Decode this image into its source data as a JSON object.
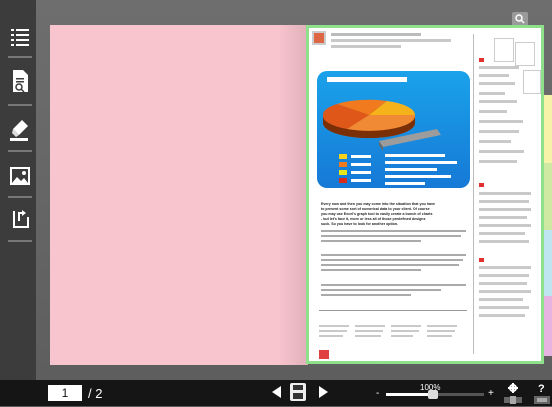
{
  "toolbar": {
    "page_current": "1",
    "page_total": "/ 2",
    "zoom_label": "100%",
    "zoom_level": 0.48,
    "zoom_minus": "-",
    "zoom_plus": "+",
    "help_label": "?",
    "prev_icon": "triangle-left-icon",
    "next_icon": "triangle-right-icon"
  },
  "sidebar": {
    "items": [
      {
        "icon": "table-of-contents-icon"
      },
      {
        "icon": "document-search-icon"
      },
      {
        "icon": "highlighter-icon"
      },
      {
        "icon": "image-icon"
      },
      {
        "icon": "share-icon"
      }
    ]
  },
  "document": {
    "body_lines": [
      "Every now and then you may come into the situation that you have",
      "to present some sort of numerical data to your client. Of course",
      "you may use Excel's graph tool to easily create a bunch of charts",
      "- but let's face it, more or less all of those predefined designs",
      "suck. So you have to look for another option."
    ]
  },
  "colors": {
    "left_page": "#f8c4ce",
    "page_border": "#8ee08a",
    "chart_bg": "#1a8ce0",
    "tabs": [
      "#f6f3a8",
      "#cfe9a2",
      "#bfe6f0",
      "#e7b4e2"
    ]
  }
}
